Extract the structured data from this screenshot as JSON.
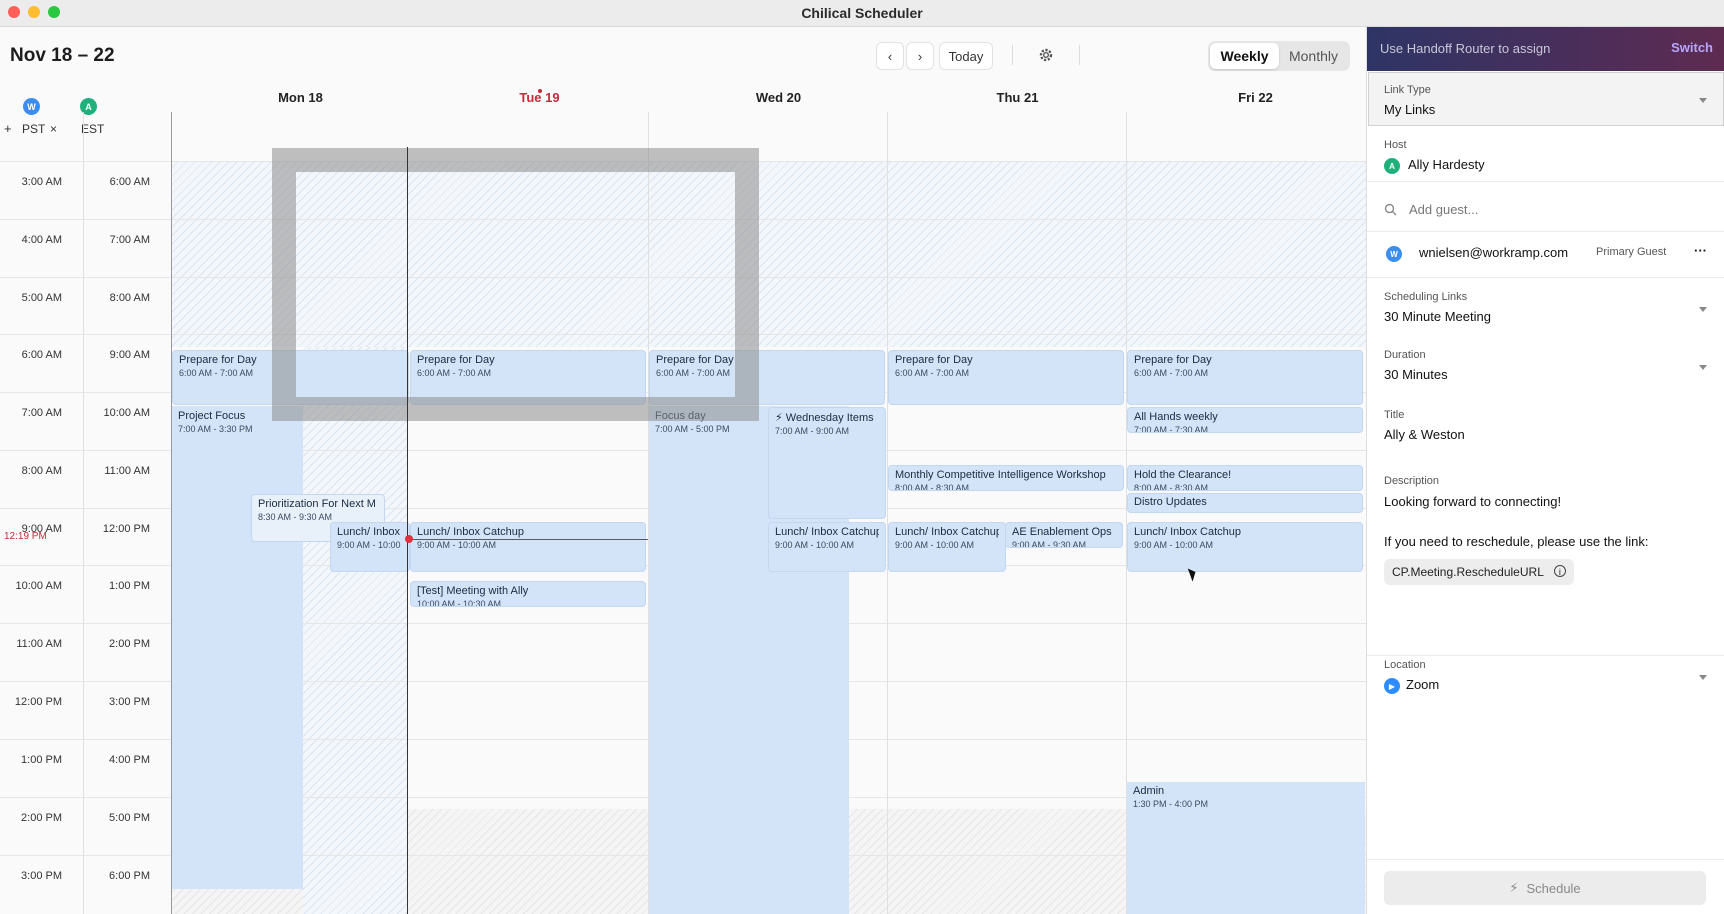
{
  "window": {
    "title": "Chilical Scheduler"
  },
  "toolbar": {
    "range": "Nov 18 – 22",
    "prev": "‹",
    "next": "›",
    "today": "Today",
    "settings_icon": "gear-icon",
    "views": [
      "Weekly",
      "Monthly"
    ],
    "active_view": "Weekly"
  },
  "timezones": [
    {
      "initial": "W",
      "label": "PST",
      "color": "#3b8ef0"
    },
    {
      "initial": "A",
      "label": "EST",
      "color": "#1fb07c"
    }
  ],
  "timezone_add": "+",
  "timezone_remove": "×",
  "days": [
    {
      "label": "Mon 18",
      "today": false
    },
    {
      "label": "Tue 19",
      "today": true
    },
    {
      "label": "Wed 20",
      "today": false
    },
    {
      "label": "Thu 21",
      "today": false
    },
    {
      "label": "Fri 22",
      "today": false
    }
  ],
  "hours_pst": [
    "3:00 AM",
    "4:00 AM",
    "5:00 AM",
    "6:00 AM",
    "7:00 AM",
    "8:00 AM",
    "9:00 AM",
    "10:00 AM",
    "11:00 AM",
    "12:00 PM",
    "1:00 PM",
    "2:00 PM",
    "3:00 PM"
  ],
  "hours_est": [
    "6:00 AM",
    "7:00 AM",
    "8:00 AM",
    "9:00 AM",
    "10:00 AM",
    "11:00 AM",
    "12:00 PM",
    "1:00 PM",
    "2:00 PM",
    "3:00 PM",
    "4:00 PM",
    "5:00 PM",
    "6:00 PM"
  ],
  "now_label": "12:19 PM",
  "events": {
    "mon_prepare": {
      "title": "Prepare for Day",
      "time": "6:00 AM - 7:00 AM"
    },
    "mon_focus": {
      "title": "Project Focus",
      "time": "7:00 AM - 3:30 PM"
    },
    "mon_prior": {
      "title": "Prioritization For Next M",
      "time": "8:30 AM - 9:30 AM"
    },
    "mon_lunch": {
      "title": "Lunch/ Inbox",
      "time": "9:00 AM - 10:00"
    },
    "tue_prepare": {
      "title": "Prepare for Day",
      "time": "6:00 AM - 7:00 AM"
    },
    "tue_lunch": {
      "title": "Lunch/ Inbox Catchup",
      "time": "9:00 AM - 10:00 AM"
    },
    "tue_test": {
      "title": "[Test] Meeting with Ally",
      "time": "10:00 AM - 10:30 AM"
    },
    "wed_prepare": {
      "title": "Prepare for Day",
      "time": "6:00 AM - 7:00 AM"
    },
    "wed_focus": {
      "title": "Focus day",
      "time": "7:00 AM - 5:00 PM"
    },
    "wed_items": {
      "title": "⚡ Wednesday Items",
      "time": "7:00 AM - 9:00 AM"
    },
    "wed_lunch": {
      "title": "Lunch/ Inbox Catchup",
      "time": "9:00 AM - 10:00 AM"
    },
    "thu_prepare": {
      "title": "Prepare for Day",
      "time": "6:00 AM - 7:00 AM"
    },
    "thu_workshop": {
      "title": "Monthly Competitive Intelligence Workshop",
      "time": "8:00 AM - 8:30 AM"
    },
    "thu_lunch": {
      "title": "Lunch/ Inbox Catchup",
      "time": "9:00 AM - 10:00 AM"
    },
    "thu_ae": {
      "title": "AE Enablement Ops",
      "time": "9:00 AM - 9:30 AM"
    },
    "fri_prepare": {
      "title": "Prepare for Day",
      "time": "6:00 AM - 7:00 AM"
    },
    "fri_allhands": {
      "title": "All Hands weekly",
      "time": "7:00 AM - 7:30 AM"
    },
    "fri_hold": {
      "title": "Hold the Clearance!",
      "time": "8:00 AM - 8:30 AM"
    },
    "fri_distro": {
      "title": "Distro Updates",
      "time": ""
    },
    "fri_lunch": {
      "title": "Lunch/ Inbox Catchup",
      "time": "9:00 AM - 10:00 AM"
    },
    "fri_admin": {
      "title": "Admin",
      "time": "1:30 PM - 4:00 PM"
    }
  },
  "panel": {
    "banner_text": "Use Handoff Router to assign",
    "banner_action": "Switch",
    "link_type_label": "Link Type",
    "link_type_value": "My Links",
    "host_label": "Host",
    "host_initial": "A",
    "host_name": "Ally Hardesty",
    "guest_placeholder": "Add guest...",
    "guest_initial": "W",
    "guest_email": "wnielsen@workramp.com",
    "guest_role": "Primary Guest",
    "guest_more": "···",
    "scheduling_label": "Scheduling Links",
    "scheduling_value": "30 Minute Meeting",
    "duration_label": "Duration",
    "duration_value": "30 Minutes",
    "title_label": "Title",
    "title_value": "Ally & Weston",
    "description_label": "Description",
    "description_line1": "Looking forward to connecting!",
    "description_line2": "If you need to reschedule, please use the link:",
    "reschedule_token": "CP.Meeting.RescheduleURL",
    "info_glyph": "i",
    "location_label": "Location",
    "location_value": "Zoom",
    "schedule_button": "Schedule"
  },
  "colors": {
    "accent_blue": "#d3e4f8",
    "today_red": "#c7293a",
    "banner_start": "#2e3566",
    "banner_end": "#5e2b50"
  }
}
